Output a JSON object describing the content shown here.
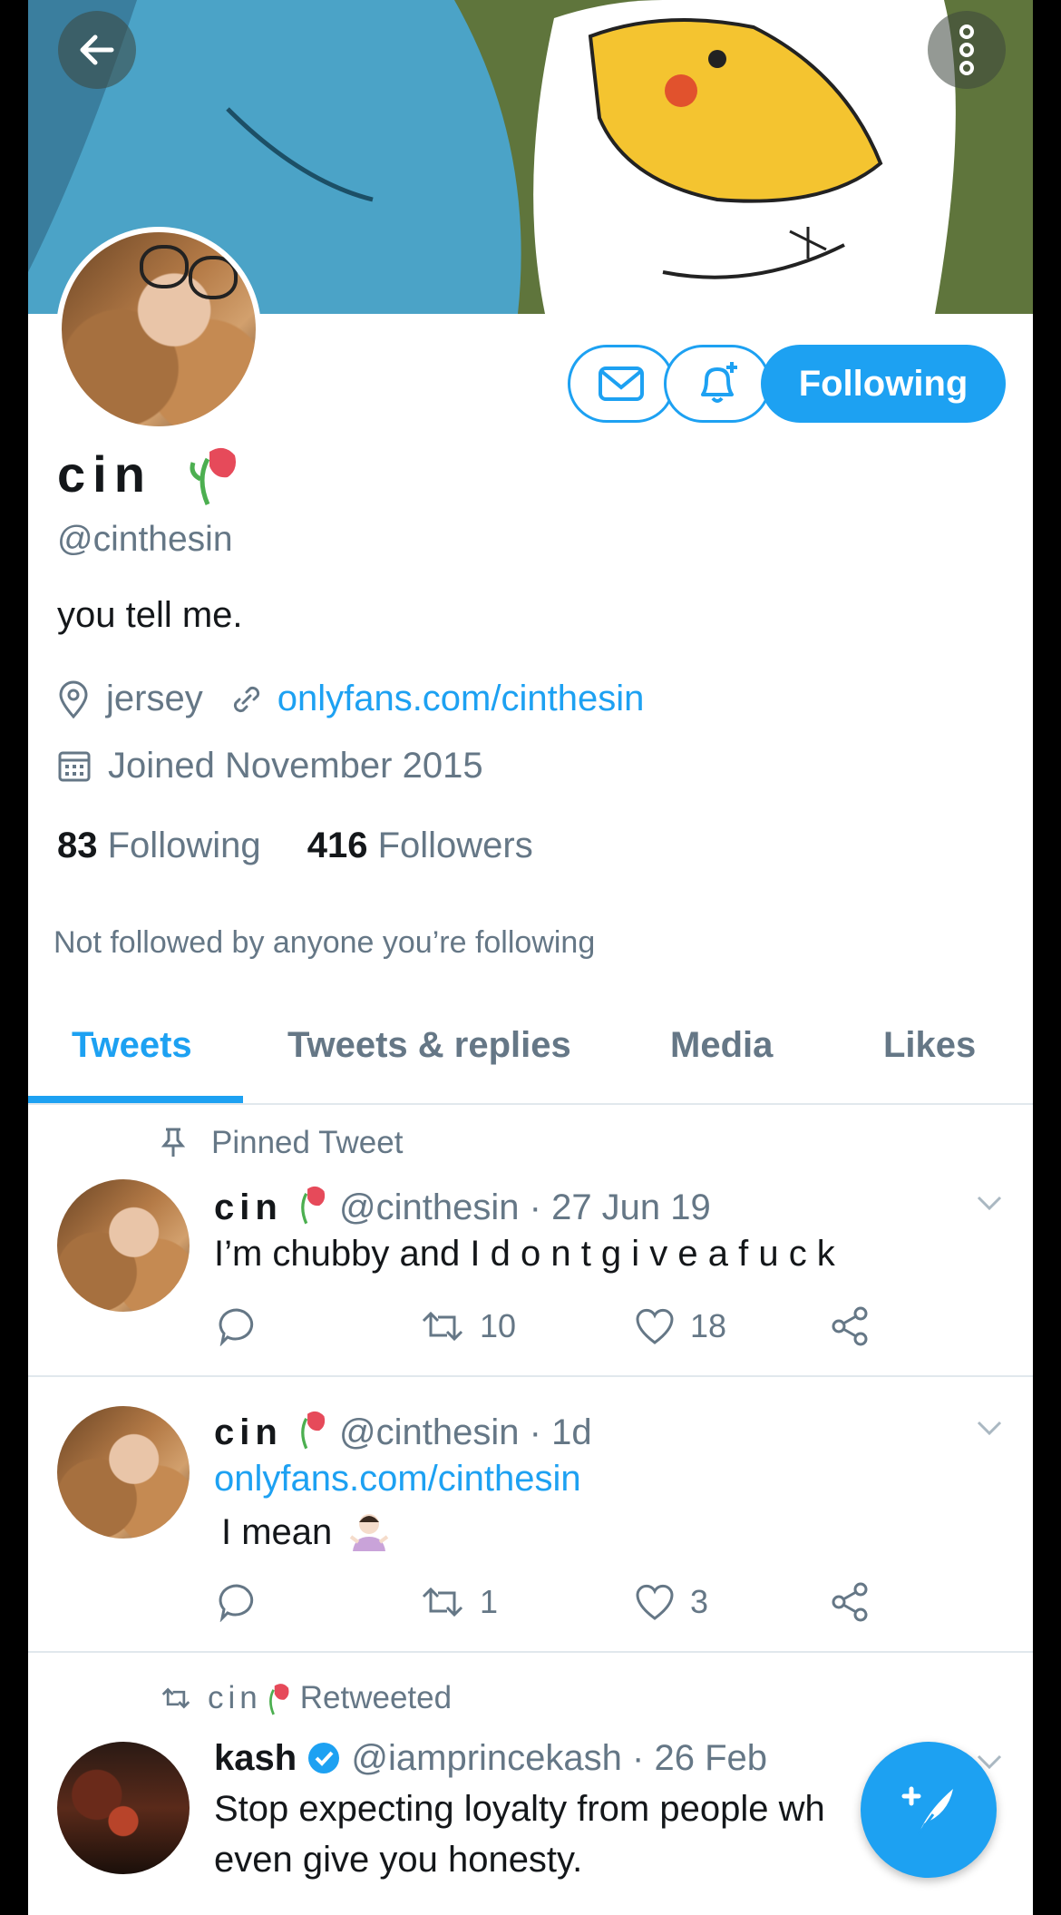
{
  "header": {
    "back_icon": "arrow-left-icon",
    "menu_icon": "more-vertical-icon"
  },
  "profile": {
    "name": "cin",
    "name_emoji": "wilted-flower",
    "handle": "@cinthesin",
    "bio": "you tell me.",
    "location": "jersey",
    "website": "onlyfans.com/cinthesin",
    "joined": "Joined November 2015",
    "following_count": "83",
    "following_label": "Following",
    "followers_count": "416",
    "followers_label": "Followers",
    "not_followed": "Not followed by anyone you’re following"
  },
  "actions": {
    "follow_label": "Following"
  },
  "tabs": [
    {
      "label": "Tweets",
      "active": true
    },
    {
      "label": "Tweets & replies"
    },
    {
      "label": "Media"
    },
    {
      "label": "Likes"
    }
  ],
  "tweets": [
    {
      "context": "Pinned Tweet",
      "name": "cin",
      "meta": "@cinthesin · 27 Jun 19",
      "text": "I’m chubby and I d o n t g i v e a f u c k",
      "retweets": "10",
      "likes": "18"
    },
    {
      "name": "cin",
      "meta": "@cinthesin · 1d",
      "link": "onlyfans.com/cinthesin",
      "text": "I mean",
      "retweets": "1",
      "likes": "3"
    },
    {
      "context_name": "cin",
      "context_suffix": "Retweeted",
      "name": "kash",
      "meta": "@iamprincekash · 26 Feb",
      "line1": "Stop expecting loyalty from people wh",
      "line2": "even give you honesty."
    }
  ],
  "colors": {
    "accent": "#1da1f2",
    "secondary_text": "#657786",
    "divider": "#e1e8ed"
  }
}
